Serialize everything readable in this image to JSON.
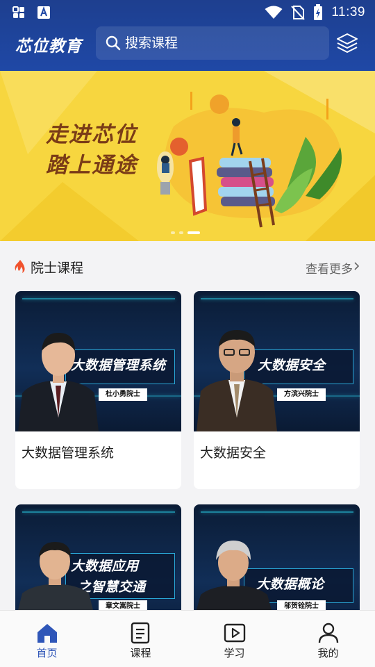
{
  "status_bar": {
    "time": "11:39"
  },
  "header": {
    "logo": "芯位教育",
    "search_placeholder": "搜索课程"
  },
  "banner": {
    "title_line1": "走进芯位",
    "title_line2": "踏上通途",
    "slides": 3,
    "active_slide": 3
  },
  "section": {
    "title": "院士课程",
    "more": "查看更多"
  },
  "courses": [
    {
      "title": "大数据管理系统",
      "thumb_title": "大数据管理系统",
      "tag": "杜小勇院士"
    },
    {
      "title": "大数据安全",
      "thumb_title": "大数据安全",
      "tag": "方滨兴院士"
    },
    {
      "title": "大数据应用之智慧交通",
      "thumb_title": "大数据应用",
      "thumb_title2": "之智慧交通",
      "tag": "章文嵩院士"
    },
    {
      "title": "大数据概论",
      "thumb_title": "大数据概论",
      "tag": "邬贺铨院士"
    }
  ],
  "tabs": [
    {
      "label": "首页",
      "icon": "home-icon",
      "active": true
    },
    {
      "label": "课程",
      "icon": "document-icon",
      "active": false
    },
    {
      "label": "学习",
      "icon": "play-icon",
      "active": false
    },
    {
      "label": "我的",
      "icon": "person-icon",
      "active": false
    }
  ],
  "colors": {
    "header": "#1f48a6",
    "banner": "#f7d63f",
    "active_tab": "#2f56b8"
  }
}
